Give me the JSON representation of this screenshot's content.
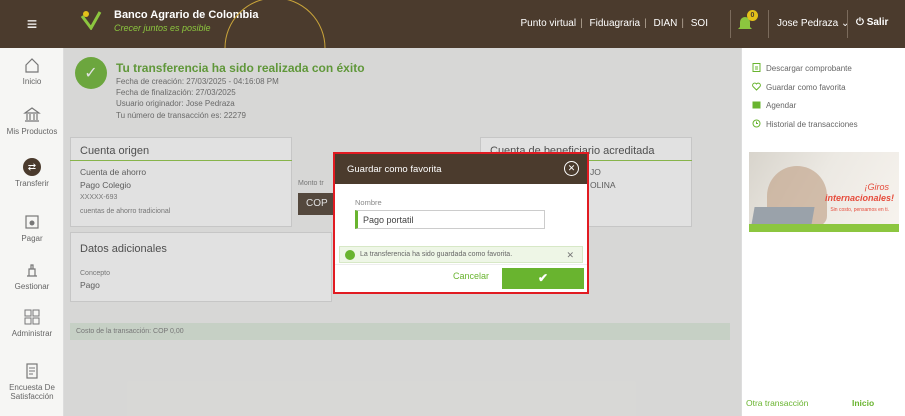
{
  "header": {
    "brand": "Banco Agrario de Colombia",
    "tagline": "Crecer juntos es posible",
    "links": [
      "Punto virtual",
      "Fiduagraria",
      "DIAN",
      "SOI"
    ],
    "notification_count": "0",
    "user": "Jose Pedraza",
    "logout": "Salir"
  },
  "sidebar": {
    "items": [
      {
        "label": "Inicio",
        "icon": "home-icon"
      },
      {
        "label": "Mis Productos",
        "icon": "bank-icon"
      },
      {
        "label": "Transferir",
        "icon": "transfer-icon"
      },
      {
        "label": "Pagar",
        "icon": "payment-icon"
      },
      {
        "label": "Gestionar",
        "icon": "manage-icon"
      },
      {
        "label": "Administrar",
        "icon": "grid-icon"
      },
      {
        "label": "Encuesta De Satisfacción",
        "icon": "survey-icon"
      }
    ]
  },
  "success": {
    "title": "Tu transferencia ha sido realizada con éxito",
    "created": "Fecha de creación: 27/03/2025 - 04:16:08 PM",
    "finalized": "Fecha de finalización: 27/03/2025",
    "originator": "Usuario originador: Jose Pedraza",
    "transaction": "Tu número de transacción es: 22279"
  },
  "origin": {
    "title": "Cuenta origen",
    "type": "Cuenta de ahorro",
    "name": "Pago Colegio",
    "number": "XXXXX-693",
    "desc": "cuentas de ahorro tradicional"
  },
  "amount": {
    "label": "Monto tr",
    "currency": "COP"
  },
  "beneficiary": {
    "title": "Cuenta de beneficiario acreditada",
    "line1": "JO",
    "line2": "OLINA"
  },
  "additional": {
    "title": "Datos adicionales",
    "concept_label": "Concepto",
    "concept_value": "Pago"
  },
  "cost": "Costo de la transacción: COP 0,00",
  "right": {
    "links": [
      "Descargar comprobante",
      "Guardar como favorita",
      "Agendar",
      "Historial de transacciones"
    ],
    "promo_line1": "¡Giros",
    "promo_line2": "internacionales!",
    "promo_line3": "Sin costo, pensamos en ti.",
    "other": "Otra transacción",
    "home": "Inicio"
  },
  "modal": {
    "title": "Guardar como favorita",
    "name_label": "Nombre",
    "name_value": "Pago portatil",
    "alert": "La transferencia ha sido guardada como favorita.",
    "cancel": "Cancelar",
    "confirm": "✔"
  },
  "colors": {
    "brand_brown": "#4b3b2d",
    "accent_green": "#69b42f",
    "highlight_red": "#e11b22"
  }
}
